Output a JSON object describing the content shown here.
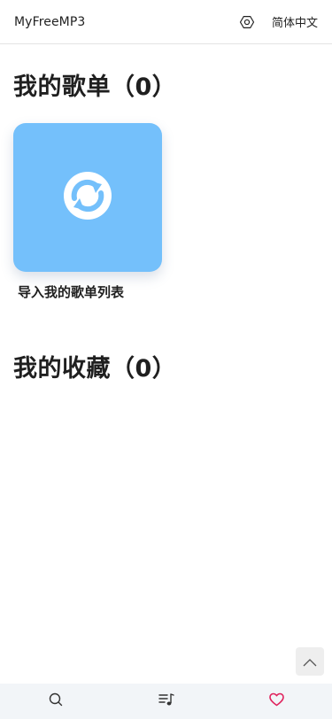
{
  "header": {
    "brand": "MyFreeMP3",
    "settings_icon": "gear-icon",
    "language": "简体中文"
  },
  "playlists": {
    "title": "我的歌单（0）",
    "import_card": {
      "label": "导入我的歌单列表",
      "icon": "sync-icon",
      "tile_color": "#74c0fb"
    }
  },
  "favorites": {
    "title": "我的收藏（0）"
  },
  "back_to_top": {
    "icon": "chevron-up-icon"
  },
  "bottom_nav": {
    "items": [
      {
        "name": "search",
        "icon": "search-icon"
      },
      {
        "name": "playlist",
        "icon": "music-list-icon"
      },
      {
        "name": "favorites",
        "icon": "heart-icon",
        "active": true,
        "color": "#e0245e"
      }
    ]
  }
}
